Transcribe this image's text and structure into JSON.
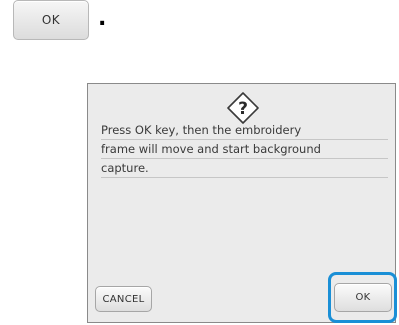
{
  "instruction": {
    "key_label": "OK",
    "trailing_punctuation": "."
  },
  "dialog": {
    "icon": "question-icon",
    "message_lines": [
      "Press OK key, then the embroidery",
      "frame will move and start background",
      "capture."
    ],
    "cancel_label": "CANCEL",
    "ok_label": "OK"
  },
  "colors": {
    "highlight": "#1a8fd6",
    "screen_bg": "#ebebeb"
  }
}
